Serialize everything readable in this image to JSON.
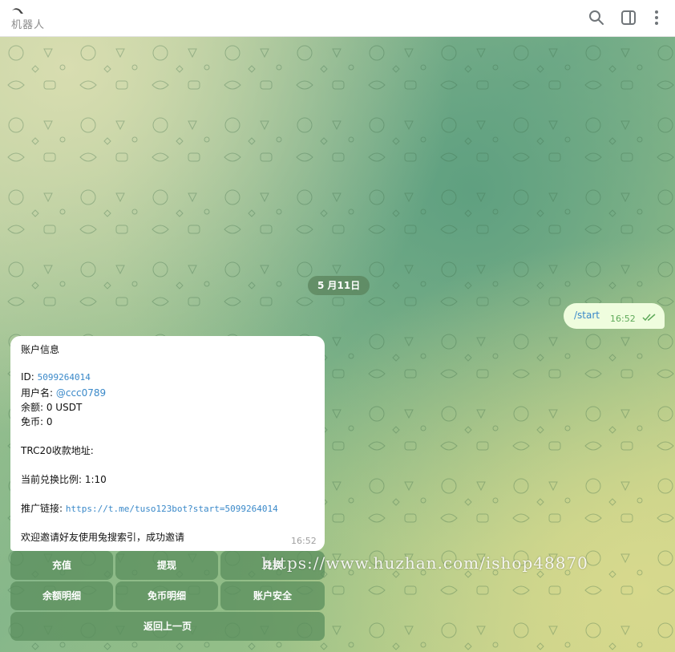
{
  "header": {
    "title": "机器人",
    "icons": [
      "search-icon",
      "sidebar-toggle-icon",
      "more-vertical-icon"
    ]
  },
  "chat": {
    "date": "5 月11日",
    "outgoing": {
      "text": "/start",
      "time": "16:52",
      "status": "read"
    },
    "incoming": {
      "title": "账户信息",
      "id_label": "ID: ",
      "id_value": "5099264014",
      "username_label": "用户名: ",
      "username_value": "@ccc0789",
      "balance": "余额: 0  USDT",
      "coins": "免币: 0",
      "trc20": "TRC20收款地址:",
      "ratio": "当前兑换比例:  1:10",
      "promo_label": "推广链接: ",
      "promo_link": "https://t.me/tuso123bot?start=5099264014",
      "invite": "欢迎邀请好友使用兔搜索引，成功邀请",
      "time": "16:52"
    }
  },
  "keyboard": {
    "rows": [
      [
        "充值",
        "提现",
        "兑换"
      ],
      [
        "余额明细",
        "免币明细",
        "账户安全"
      ],
      [
        "返回上一页"
      ]
    ]
  },
  "watermark": "https://www.huzhan.com/ishop48870",
  "colors": {
    "outgoing_bubble": "#effdde",
    "link": "#3a89c9",
    "keyboard_button": "#5a8e5c"
  }
}
